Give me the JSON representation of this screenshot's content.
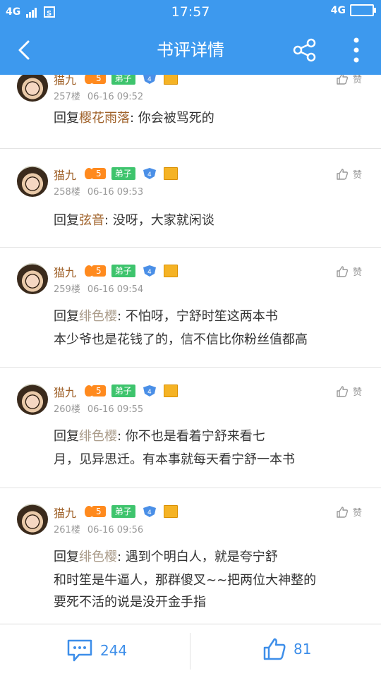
{
  "status_bar": {
    "network": "4G",
    "sim_icon": "sim-card-icon",
    "time": "17:57",
    "network_right": "4G"
  },
  "header": {
    "title": "书评详情",
    "back_icon": "chevron-left-icon",
    "share_icon": "share-icon",
    "more_icon": "more-vertical-icon"
  },
  "comments": [
    {
      "username": "猫九",
      "level": "5",
      "role": "弟子",
      "vip_level": "4",
      "floor": "257楼",
      "time": "06-16 09:52",
      "like_label": "赞",
      "reply_prefix": "回复",
      "reply_to": "樱花雨落",
      "fancy": false,
      "text_line1": ": 你会被骂死的",
      "text_line2": "",
      "text_line3": ""
    },
    {
      "username": "猫九",
      "level": "5",
      "role": "弟子",
      "vip_level": "4",
      "floor": "258楼",
      "time": "06-16 09:53",
      "like_label": "赞",
      "reply_prefix": "回复",
      "reply_to": "弦音",
      "fancy": false,
      "text_line1": ": 没呀，大家就闲谈",
      "text_line2": "",
      "text_line3": ""
    },
    {
      "username": "猫九",
      "level": "5",
      "role": "弟子",
      "vip_level": "4",
      "floor": "259楼",
      "time": "06-16 09:54",
      "like_label": "赞",
      "reply_prefix": "回复",
      "reply_to": "绯色樱",
      "fancy": true,
      "text_line1": ": 不怕呀，宁舒时笙这两本书",
      "text_line2": "本少爷也是花钱了的，信不信比你粉丝值都高",
      "text_line3": ""
    },
    {
      "username": "猫九",
      "level": "5",
      "role": "弟子",
      "vip_level": "4",
      "floor": "260楼",
      "time": "06-16 09:55",
      "like_label": "赞",
      "reply_prefix": "回复",
      "reply_to": "绯色樱",
      "fancy": true,
      "text_line1": ": 你不也是看着宁舒来看七",
      "text_line2": "月，见异思迁。有本事就每天看宁舒一本书",
      "text_line3": ""
    },
    {
      "username": "猫九",
      "level": "5",
      "role": "弟子",
      "vip_level": "4",
      "floor": "261楼",
      "time": "06-16 09:56",
      "like_label": "赞",
      "reply_prefix": "回复",
      "reply_to": "绯色樱",
      "fancy": true,
      "text_line1": ": 遇到个明白人，就是夸宁舒",
      "text_line2": "和时笙是牛逼人，那群傻叉~~把两位大神整的",
      "text_line3": "要死不活的说是没开金手指"
    }
  ],
  "bottom_bar": {
    "comment_count": "244",
    "like_count": "81",
    "comment_icon": "comment-bubble-icon",
    "like_icon": "thumbs-up-icon"
  },
  "colors": {
    "accent": "#3d99ee",
    "username": "#a0622a",
    "level_badge": "#ff8a1e",
    "disciple_badge": "#3ec46d"
  }
}
